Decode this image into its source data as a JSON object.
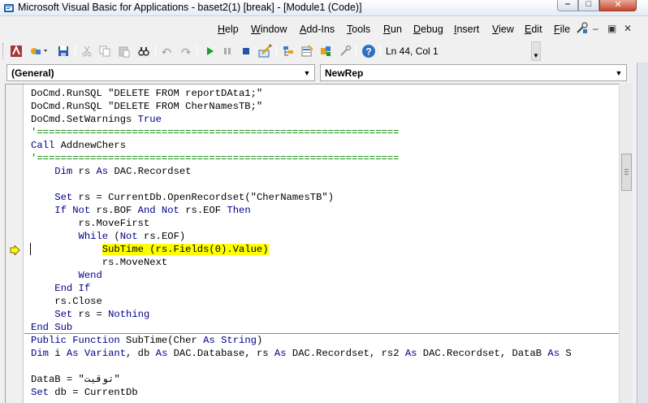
{
  "window": {
    "title": "Microsoft Visual Basic for Applications - baset2(1) [break] - [Module1 (Code)]",
    "min_symbol": "–",
    "max_symbol": "□",
    "close_symbol": "✕"
  },
  "menu": {
    "items": [
      "Help",
      "Window",
      "Add-Ins",
      "Tools",
      "Run",
      "Debug",
      "Insert",
      "View",
      "Edit",
      "File"
    ],
    "mini_min": "–",
    "mini_restore": "▣",
    "mini_close": "✕"
  },
  "toolbar": {
    "position_text": "Ln 44, Col 1",
    "icons": [
      "design-mode-icon",
      "toolbox-icon",
      "object-browser-icon",
      "properties-icon",
      "project-explorer-icon",
      "design-mode-toggle-icon",
      "reset-icon",
      "break-icon",
      "run-icon",
      "redo-icon",
      "undo-icon",
      "find-icon",
      "paste-icon",
      "copy-icon",
      "cut-icon",
      "save-icon",
      "insert-icon",
      "view-access-icon",
      "help-icon"
    ]
  },
  "selectors": {
    "object": "(General)",
    "procedure": "NewRep"
  },
  "colors": {
    "keyword": "#00008b",
    "comment": "#008000",
    "highlight": "#ffff00"
  },
  "code_lines": [
    [
      {
        "t": "DoCmd.RunSQL \"DELETE FROM reportDAta1;\"",
        "c": ""
      }
    ],
    [
      {
        "t": "DoCmd.RunSQL \"DELETE FROM CherNamesTB;\"",
        "c": ""
      }
    ],
    [
      {
        "t": "DoCmd.SetWarnings ",
        "c": ""
      },
      {
        "t": "True",
        "c": "kw"
      }
    ],
    [
      {
        "t": "'=============================================================",
        "c": "cm"
      }
    ],
    [
      {
        "t": "Call",
        "c": "kw"
      },
      {
        "t": " AddnewChers",
        "c": ""
      }
    ],
    [
      {
        "t": "'=============================================================",
        "c": "cm"
      }
    ],
    [
      {
        "t": "    ",
        "c": ""
      },
      {
        "t": "Dim",
        "c": "kw"
      },
      {
        "t": " rs ",
        "c": ""
      },
      {
        "t": "As",
        "c": "kw"
      },
      {
        "t": " DAC.Recordset",
        "c": ""
      }
    ],
    [
      {
        "t": "",
        "c": ""
      }
    ],
    [
      {
        "t": "    ",
        "c": ""
      },
      {
        "t": "Set",
        "c": "kw"
      },
      {
        "t": " rs = CurrentDb.OpenRecordset(\"CherNamesTB\")",
        "c": ""
      }
    ],
    [
      {
        "t": "    ",
        "c": ""
      },
      {
        "t": "If Not",
        "c": "kw"
      },
      {
        "t": " rs.BOF ",
        "c": ""
      },
      {
        "t": "And Not",
        "c": "kw"
      },
      {
        "t": " rs.EOF ",
        "c": ""
      },
      {
        "t": "Then",
        "c": "kw"
      }
    ],
    [
      {
        "t": "        rs.MoveFirst",
        "c": ""
      }
    ],
    [
      {
        "t": "        ",
        "c": ""
      },
      {
        "t": "While",
        "c": "kw"
      },
      {
        "t": " (",
        "c": ""
      },
      {
        "t": "Not",
        "c": "kw"
      },
      {
        "t": " rs.EOF)",
        "c": ""
      }
    ],
    [
      {
        "t": "            ",
        "c": ""
      },
      {
        "t": "SubTime (rs.Fields(0).Value)",
        "c": "hl"
      }
    ],
    [
      {
        "t": "            rs.MoveNext",
        "c": ""
      }
    ],
    [
      {
        "t": "        ",
        "c": ""
      },
      {
        "t": "Wend",
        "c": "kw"
      }
    ],
    [
      {
        "t": "    ",
        "c": ""
      },
      {
        "t": "End If",
        "c": "kw"
      }
    ],
    [
      {
        "t": "    rs.Close",
        "c": ""
      }
    ],
    [
      {
        "t": "    ",
        "c": ""
      },
      {
        "t": "Set",
        "c": "kw"
      },
      {
        "t": " rs = ",
        "c": ""
      },
      {
        "t": "Nothing",
        "c": "kw"
      }
    ],
    [
      {
        "t": "End Sub",
        "c": "kw"
      }
    ],
    [
      {
        "t": "Public Function",
        "c": "kw"
      },
      {
        "t": " SubTime(Cher ",
        "c": ""
      },
      {
        "t": "As String",
        "c": "kw"
      },
      {
        "t": ")",
        "c": ""
      }
    ],
    [
      {
        "t": "Dim",
        "c": "kw"
      },
      {
        "t": " i ",
        "c": ""
      },
      {
        "t": "As Variant",
        "c": "kw"
      },
      {
        "t": ", db ",
        "c": ""
      },
      {
        "t": "As",
        "c": "kw"
      },
      {
        "t": " DAC.Database, rs ",
        "c": ""
      },
      {
        "t": "As",
        "c": "kw"
      },
      {
        "t": " DAC.Recordset, rs2 ",
        "c": ""
      },
      {
        "t": "As",
        "c": "kw"
      },
      {
        "t": " DAC.Recordset, DataB ",
        "c": ""
      },
      {
        "t": "As",
        "c": "kw"
      },
      {
        "t": " S",
        "c": ""
      }
    ],
    [
      {
        "t": "",
        "c": ""
      }
    ],
    [
      {
        "t": "DataB = \"توقيت\"",
        "c": ""
      }
    ],
    [
      {
        "t": "Set",
        "c": "kw"
      },
      {
        "t": " db = CurrentDb",
        "c": ""
      }
    ]
  ]
}
